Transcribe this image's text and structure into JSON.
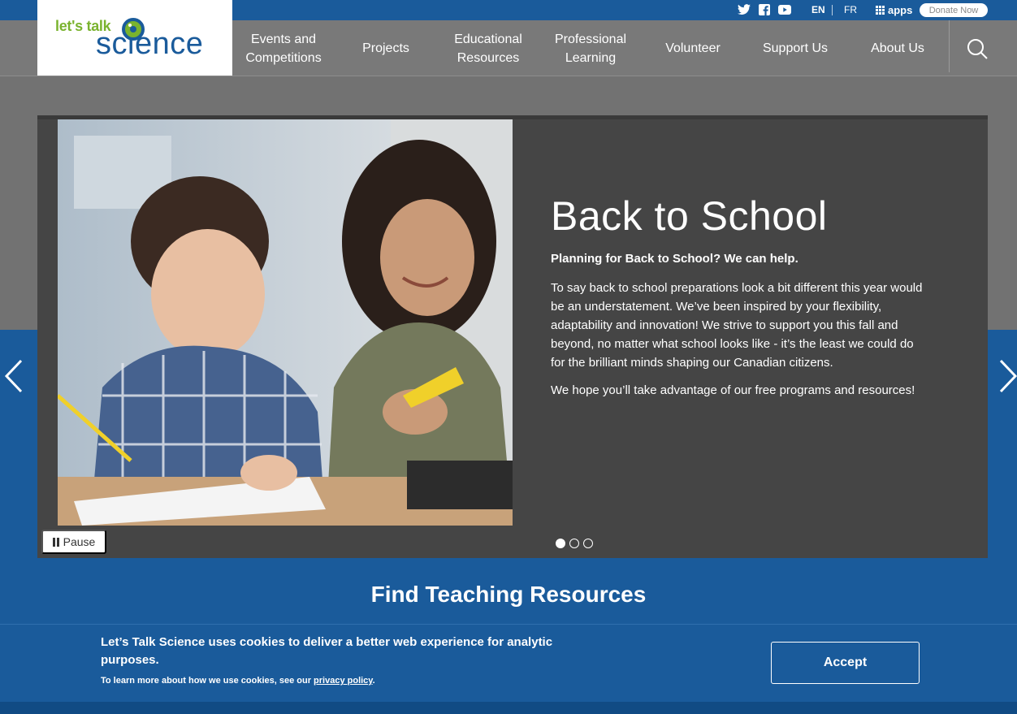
{
  "topbar": {
    "social": [
      "twitter-icon",
      "facebook-icon",
      "youtube-icon"
    ],
    "lang_en": "EN",
    "lang_fr": "FR",
    "apps_label": "apps",
    "donate_label": "Donate Now"
  },
  "logo": {
    "line1": "let's talk",
    "line2": "science"
  },
  "nav": {
    "items": [
      {
        "label": "Events and Competitions"
      },
      {
        "label": "Projects"
      },
      {
        "label": "Educational Resources"
      },
      {
        "label": "Professional Learning"
      },
      {
        "label": "Volunteer"
      },
      {
        "label": "Support Us"
      },
      {
        "label": "About Us"
      }
    ]
  },
  "slide": {
    "title": "Back to School",
    "subtitle": "Planning for Back to School? We can help.",
    "para1": "To say back to school preparations look a bit different this year would be an understatement. We’ve been inspired by your flexibility, adaptability and innovation!  We strive to support you this fall and beyond, no matter what school looks like - it’s the least we could do for the brilliant minds shaping our Canadian citizens.",
    "para2": "We hope you’ll take advantage of our free programs and resources!",
    "pause_label": "Pause",
    "dots": 3,
    "active_dot": 1
  },
  "section": {
    "title": "Find Teaching Resources"
  },
  "cookie": {
    "message": "Let’s Talk Science uses cookies to deliver a better web experience for analytic purposes.",
    "more_prefix": "To learn more about how we use cookies, see our",
    "more_link": "privacy policy",
    "more_suffix": ".",
    "accept_label": "Accept"
  },
  "colors": {
    "brand_blue": "#1a5b9b",
    "brand_green": "#7ab32e",
    "nav_grey": "#797979",
    "slide_bg": "#454545"
  }
}
